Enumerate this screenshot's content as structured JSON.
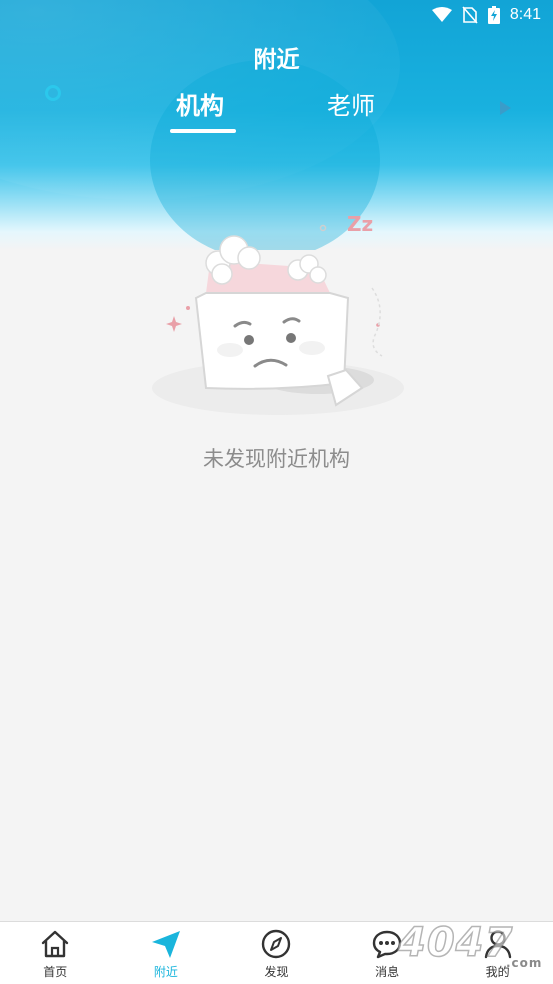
{
  "status_bar": {
    "time": "8:41"
  },
  "header": {
    "title": "附近",
    "tabs": [
      {
        "label": "机构",
        "active": true
      },
      {
        "label": "老师",
        "active": false
      }
    ]
  },
  "empty_state": {
    "message": "未发现附近机构",
    "sleep_text": "Zz"
  },
  "bottom_nav": {
    "items": [
      {
        "label": "首页",
        "icon": "home-icon",
        "active": false
      },
      {
        "label": "附近",
        "icon": "location-arrow-icon",
        "active": true
      },
      {
        "label": "发现",
        "icon": "compass-icon",
        "active": false
      },
      {
        "label": "消息",
        "icon": "chat-bubble-icon",
        "active": false
      },
      {
        "label": "我的",
        "icon": "user-icon",
        "active": false
      }
    ]
  },
  "watermark": {
    "text": "4047",
    "domain": ".com"
  },
  "colors": {
    "accent": "#1ab5dc",
    "header_top": "#12a4d6",
    "background": "#f4f4f4",
    "empty_text": "#8c8c8c"
  }
}
